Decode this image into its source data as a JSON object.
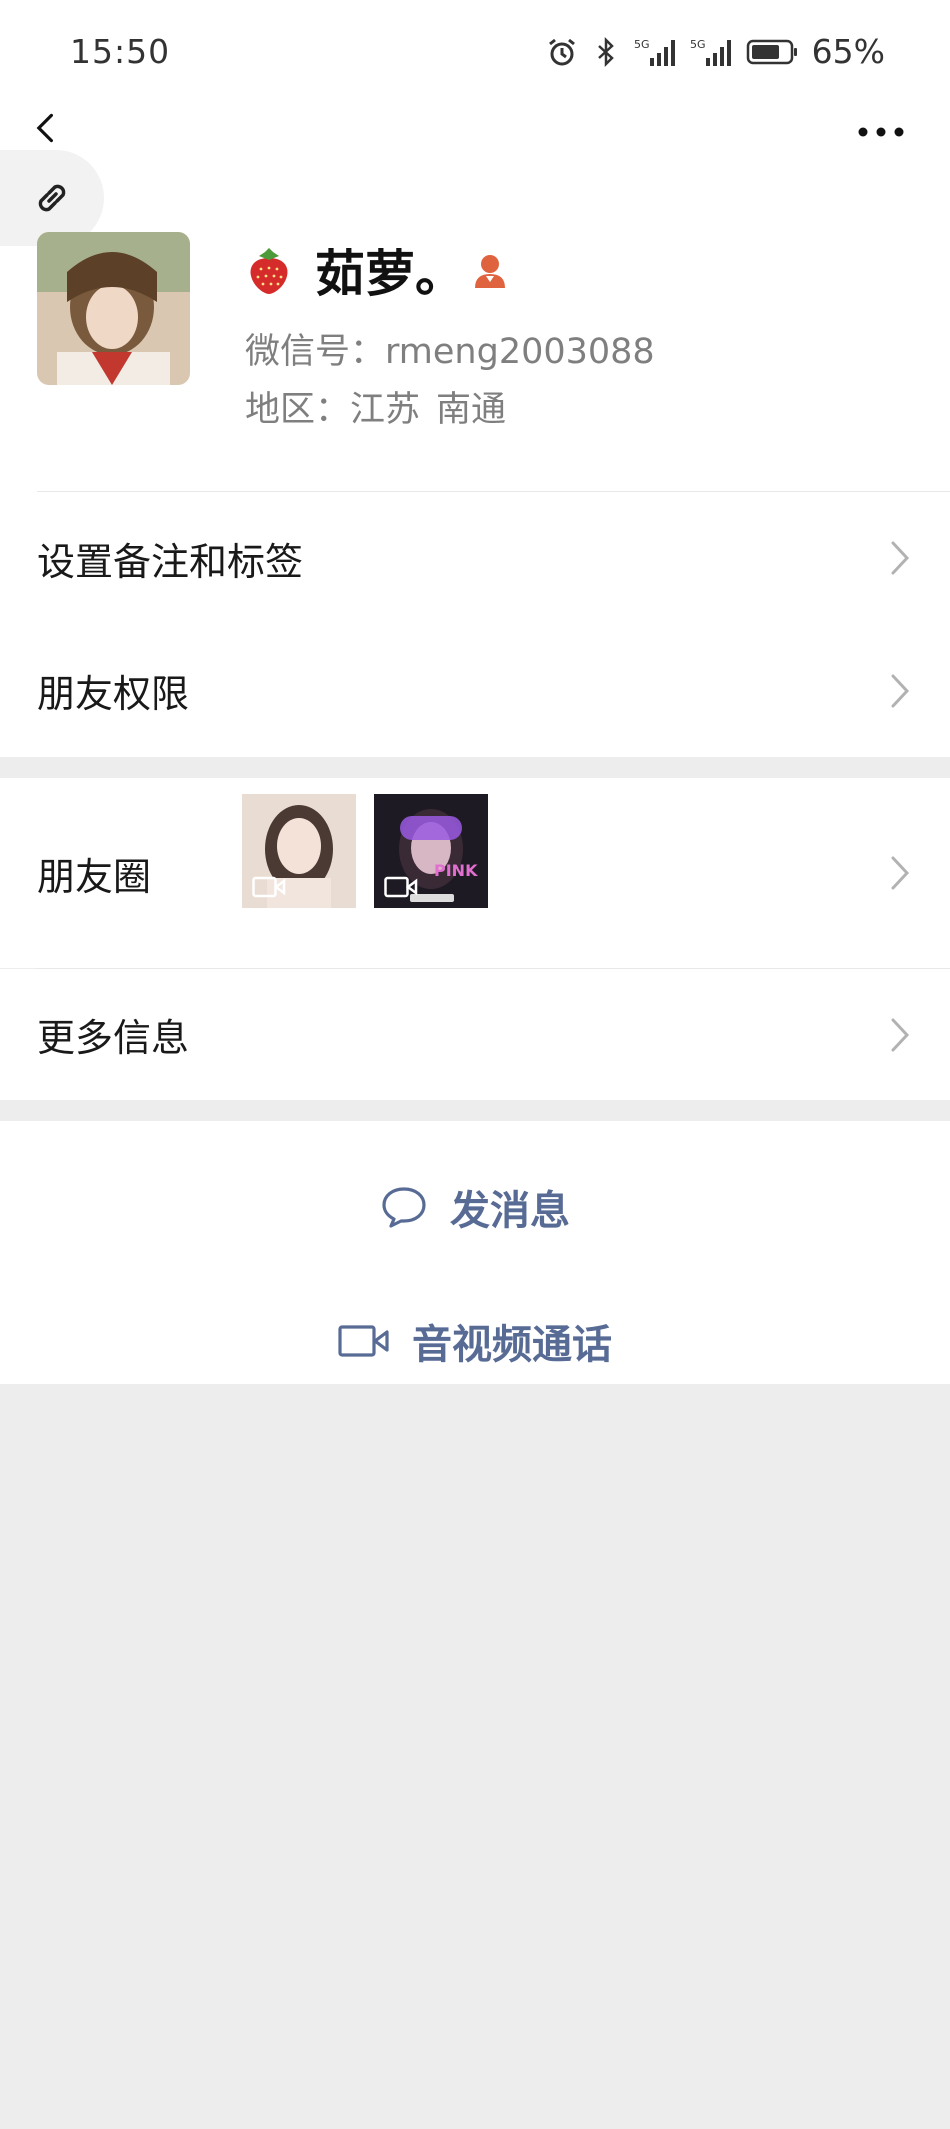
{
  "status_bar": {
    "time": "15:50",
    "battery_percent": "65%",
    "icons": [
      "alarm-icon",
      "bluetooth-icon",
      "signal-5g-icon",
      "signal-5g-icon",
      "battery-icon"
    ]
  },
  "nav": {
    "back_icon": "back-arrow-icon",
    "more_icon": "more-dots-icon",
    "link_icon": "link-icon"
  },
  "profile": {
    "nickname": "茹萝。",
    "wechat_id_label": "微信号：",
    "wechat_id": "rmeng2003088",
    "region_label": "地区：",
    "region_province": "江苏",
    "region_city": "南通"
  },
  "menu": {
    "remark_tags": "设置备注和标签",
    "friend_permissions": "朋友权限",
    "moments": "朋友圈",
    "more_info": "更多信息"
  },
  "actions": {
    "send_message": "发消息",
    "video_call": "音视频通话"
  },
  "colors": {
    "link_blue": "#576b95",
    "background": "#ededed",
    "card": "#ffffff"
  }
}
